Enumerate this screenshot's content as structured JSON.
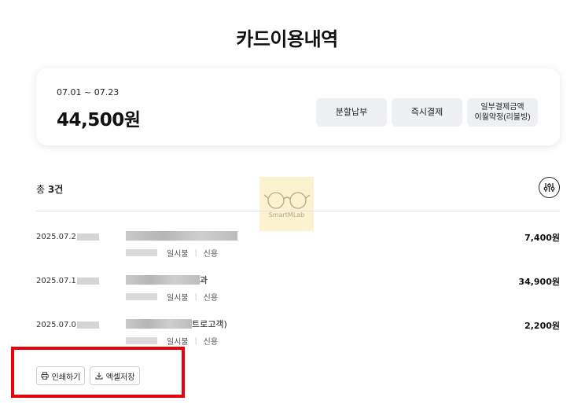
{
  "page": {
    "title": "카드이용내역"
  },
  "summary": {
    "period": "07.01 ~ 07.23",
    "total": "44,500원",
    "buttons": {
      "installment": "분할납부",
      "instant": "즉시결제",
      "partial_line1": "일부결제금액",
      "partial_line2": "이월약정(리볼빙)"
    }
  },
  "list": {
    "count_prefix": "총 ",
    "count_value": "3건",
    "transactions": [
      {
        "date": "2025.07.2",
        "merchant_suffix": "",
        "payment": "일시불",
        "type": "신용",
        "amount": "7,400원"
      },
      {
        "date": "2025.07.1",
        "merchant_suffix": "과",
        "payment": "일시불",
        "type": "신용",
        "amount": "34,900원"
      },
      {
        "date": "2025.07.0",
        "merchant_suffix": "트로고객)",
        "payment": "일시불",
        "type": "신용",
        "amount": "2,200원"
      }
    ]
  },
  "watermark": {
    "text": "SmartMLab"
  },
  "export": {
    "print_label": "인쇄하기",
    "excel_label": "엑셀저장"
  },
  "colors": {
    "highlight": "#e8000b",
    "button_bg": "#eef0f3"
  }
}
